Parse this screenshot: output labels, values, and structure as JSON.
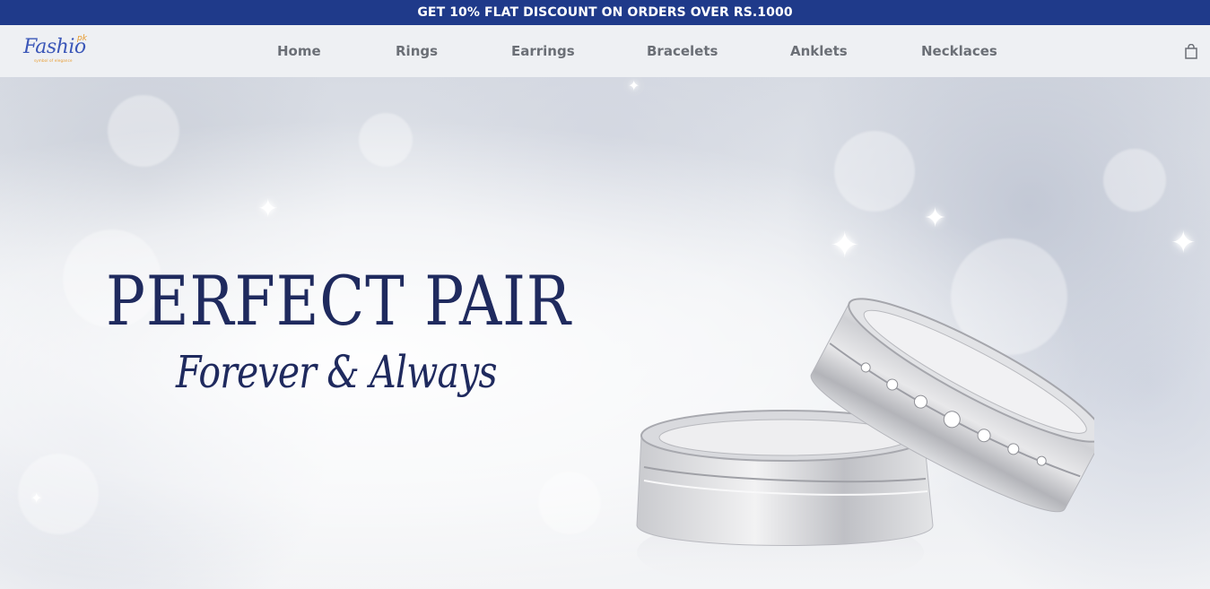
{
  "announcement": {
    "text": "GET 10% FLAT DISCOUNT ON ORDERS OVER RS.1000"
  },
  "header": {
    "logo": {
      "word": "Fashio",
      "tld": "pk",
      "tagline": "symbol of elegance"
    },
    "nav": [
      {
        "label": "Home"
      },
      {
        "label": "Rings"
      },
      {
        "label": "Earrings"
      },
      {
        "label": "Bracelets"
      },
      {
        "label": "Anklets"
      },
      {
        "label": "Necklaces"
      }
    ],
    "cart_icon": "shopping-bag-icon"
  },
  "hero": {
    "headline": "PERFECT PAIR",
    "subline": "Forever & Always"
  },
  "colors": {
    "announcement_bg": "#1f3a8a",
    "headline": "#1f2a5e",
    "nav_text": "#6b6f76",
    "logo_blue": "#3b57b8",
    "logo_orange": "#e89a2c"
  }
}
